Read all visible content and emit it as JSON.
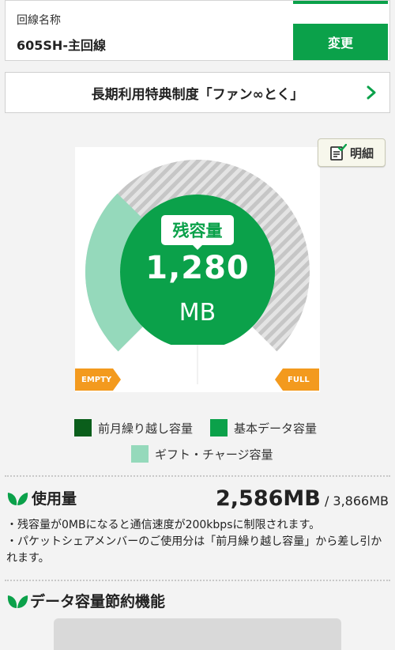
{
  "line": {
    "label": "回線名称",
    "name": "605SH-主回線",
    "change_button": "変更"
  },
  "banner": {
    "text": "長期利用特典制度「ファン∞とく」"
  },
  "detail_button": {
    "label": "明細"
  },
  "gauge": {
    "remaining_label": "残容量",
    "remaining_value": "1,280",
    "remaining_unit": "MB",
    "remaining_fraction": 0.331,
    "empty_label": "EMPTY",
    "full_label": "FULL"
  },
  "legend": {
    "carryover": "前月繰り越し容量",
    "basic": "基本データ容量",
    "gift": "ギフト・チャージ容量"
  },
  "usage": {
    "title": "使用量",
    "used": "2,586MB",
    "total": "/ 3,866MB",
    "notes": [
      "・残容量が0MBになると通信速度が200kbpsに制限されます。",
      "・パケットシェアメンバーのご使用分は「前月繰り越し容量」から差し引かれます。"
    ]
  },
  "saving": {
    "title": "データ容量節約機能"
  },
  "colors": {
    "green": "#0ba14a",
    "dark_green": "#0a5e1b",
    "light_green": "#95d9bb",
    "orange": "#f39a1e",
    "stripe_gray": "#c8c8c8"
  }
}
